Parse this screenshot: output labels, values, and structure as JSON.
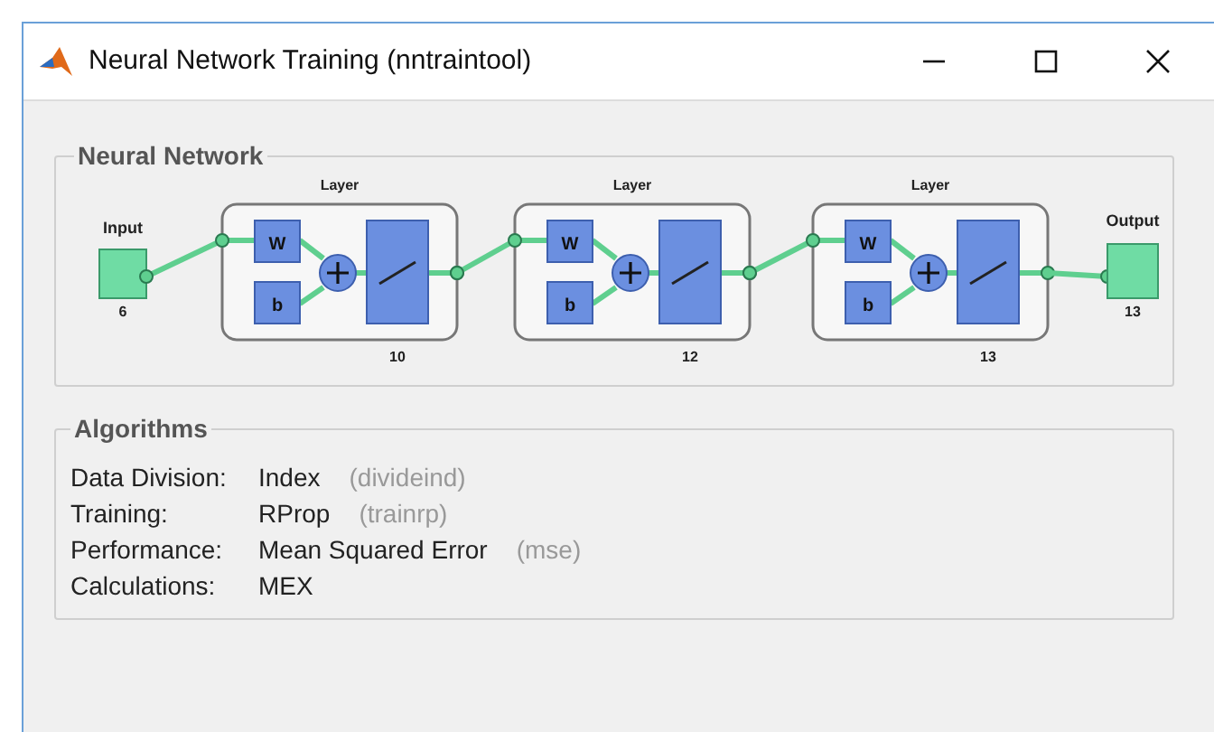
{
  "window": {
    "title": "Neural Network Training (nntraintool)"
  },
  "network": {
    "title": "Neural Network",
    "input": {
      "label": "Input",
      "size": "6"
    },
    "layers": [
      {
        "title": "Layer",
        "weight": "W",
        "bias": "b",
        "size": "10"
      },
      {
        "title": "Layer",
        "weight": "W",
        "bias": "b",
        "size": "12"
      },
      {
        "title": "Layer",
        "weight": "W",
        "bias": "b",
        "size": "13"
      }
    ],
    "output": {
      "label": "Output",
      "size": "13"
    }
  },
  "algorithms": {
    "title": "Algorithms",
    "rows": [
      {
        "label": "Data Division:",
        "value": "Index",
        "function": "(divideind)"
      },
      {
        "label": "Training:",
        "value": "RProp",
        "function": "(trainrp)"
      },
      {
        "label": "Performance:",
        "value": "Mean Squared Error",
        "function": "(mse)"
      },
      {
        "label": "Calculations:",
        "value": "MEX"
      }
    ]
  }
}
